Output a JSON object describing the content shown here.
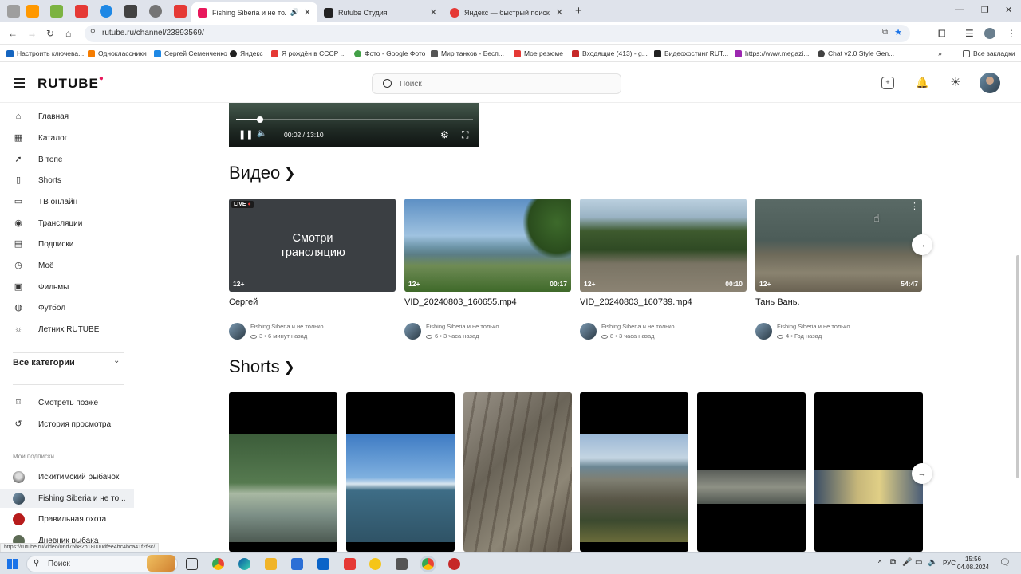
{
  "browser": {
    "tabs": [
      {
        "title": "Fishing Siberia и не только...",
        "active": true,
        "color": "#e8185b"
      },
      {
        "title": "Rutube Студия",
        "active": false,
        "color": "#222"
      },
      {
        "title": "Яндекс — быстрый поиск в и...",
        "active": false,
        "color": "#e53935"
      }
    ],
    "url": "rutube.ru/channel/23893569/",
    "bookmarks": [
      "Настроить ключева...",
      "Одноклассники",
      "Сергей Семенченко",
      "Яндекс",
      "Я рождён в СССР ...",
      "Фото - Google Фото",
      "Мир танков - Бесп...",
      "Мое резюме",
      "Входящие (413) - g...",
      "Видеохостинг RUT...",
      "https://www.megazi...",
      "Chat v2.0 Style Gen..."
    ],
    "all_bookmarks": "Все закладки"
  },
  "header": {
    "logo": "RUTUBE",
    "search_placeholder": "Поиск"
  },
  "sidebar": {
    "items": [
      {
        "label": "Главная",
        "icon": "home-icon"
      },
      {
        "label": "Каталог",
        "icon": "catalog-icon"
      },
      {
        "label": "В топе",
        "icon": "rocket-icon"
      },
      {
        "label": "Shorts",
        "icon": "shorts-icon"
      },
      {
        "label": "ТВ онлайн",
        "icon": "tv-icon"
      },
      {
        "label": "Трансляции",
        "icon": "broadcast-icon"
      },
      {
        "label": "Подписки",
        "icon": "subscriptions-icon"
      },
      {
        "label": "Моё",
        "icon": "my-icon"
      },
      {
        "label": "Фильмы",
        "icon": "film-icon"
      },
      {
        "label": "Футбол",
        "icon": "football-icon"
      },
      {
        "label": "Летних RUTUBE",
        "icon": "sun-icon"
      }
    ],
    "categories_label": "Все категории",
    "library": [
      {
        "label": "Смотреть позже",
        "icon": "bookmark-icon"
      },
      {
        "label": "История просмотра",
        "icon": "history-icon"
      }
    ],
    "subscriptions_label": "Мои подписки",
    "subscriptions": [
      {
        "label": "Искитимский рыбачок"
      },
      {
        "label": "Fishing Siberia и не то..."
      },
      {
        "label": "Правильная охота"
      },
      {
        "label": "Дневник рыбака"
      }
    ]
  },
  "player": {
    "time": "00:02 / 13:10",
    "progress": 0.1
  },
  "videos_section": {
    "title": "Видео",
    "videos": [
      {
        "title": "Сергей",
        "live": "LIVE",
        "overlay": "Смотри трансляцию",
        "age": "12+",
        "duration": "",
        "channel": "Fishing Siberia и не только..",
        "views": "3",
        "ago": "6 минут назад"
      },
      {
        "title": "VID_20240803_160655.mp4",
        "age": "12+",
        "duration": "00:17",
        "channel": "Fishing Siberia и не только..",
        "views": "6",
        "ago": "3 часа назад"
      },
      {
        "title": "VID_20240803_160739.mp4",
        "age": "12+",
        "duration": "00:10",
        "channel": "Fishing Siberia и не только..",
        "views": "8",
        "ago": "3 часа назад"
      },
      {
        "title": "Тань Вань.",
        "age": "12+",
        "duration": "54:47",
        "channel": "Fishing Siberia и не только..",
        "views": "4",
        "ago": "Год назад"
      }
    ]
  },
  "shorts_section": {
    "title": "Shorts"
  },
  "status_url": "https://rutube.ru/video/06d75b82b18000dfee4bc4bca41f2f8c/",
  "taskbar": {
    "search_label": "Поиск",
    "lang": "РУС",
    "time": "15:56",
    "date": "04.08.2024"
  }
}
